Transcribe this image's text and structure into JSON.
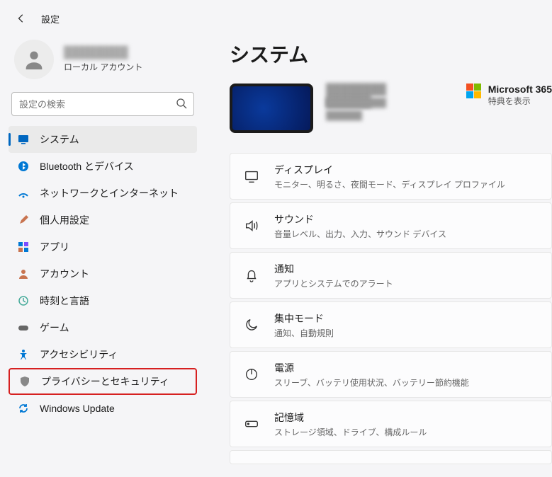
{
  "header": {
    "title": "設定"
  },
  "profile": {
    "name": "████████",
    "account_type": "ローカル アカウント"
  },
  "search": {
    "placeholder": "設定の検索"
  },
  "nav": [
    {
      "label": "システム",
      "icon": "system",
      "active": true
    },
    {
      "label": "Bluetooth とデバイス",
      "icon": "bluetooth"
    },
    {
      "label": "ネットワークとインターネット",
      "icon": "network"
    },
    {
      "label": "個人用設定",
      "icon": "personalize"
    },
    {
      "label": "アプリ",
      "icon": "apps"
    },
    {
      "label": "アカウント",
      "icon": "account"
    },
    {
      "label": "時刻と言語",
      "icon": "time"
    },
    {
      "label": "ゲーム",
      "icon": "gaming"
    },
    {
      "label": "アクセシビリティ",
      "icon": "accessibility"
    },
    {
      "label": "プライバシーとセキュリティ",
      "icon": "privacy",
      "boxed": true
    },
    {
      "label": "Windows Update",
      "icon": "update"
    }
  ],
  "page": {
    "title": "システム"
  },
  "device": {
    "name": "████████ ██████",
    "sub1": "██████████",
    "sub2": "██████"
  },
  "ms365": {
    "title": "Microsoft 365",
    "subtitle": "特典を表示"
  },
  "cards": [
    {
      "title": "ディスプレイ",
      "subtitle": "モニター、明るさ、夜間モード、ディスプレイ プロファイル",
      "icon": "display"
    },
    {
      "title": "サウンド",
      "subtitle": "音量レベル、出力、入力、サウンド デバイス",
      "icon": "sound"
    },
    {
      "title": "通知",
      "subtitle": "アプリとシステムでのアラート",
      "icon": "notify"
    },
    {
      "title": "集中モード",
      "subtitle": "通知、自動規則",
      "icon": "focus"
    },
    {
      "title": "電源",
      "subtitle": "スリーブ、バッテリ使用状況、バッテリー節約機能",
      "icon": "power"
    },
    {
      "title": "記憶域",
      "subtitle": "ストレージ領域、ドライブ、構成ルール",
      "icon": "storage"
    }
  ]
}
